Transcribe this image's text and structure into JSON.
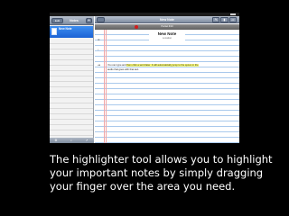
{
  "status_bar": {
    "time": ""
  },
  "left_pane": {
    "edit_label": "Edit",
    "title": "Notes",
    "add_label": "+",
    "selected_note": {
      "title": "New Note",
      "date": ""
    },
    "bottom_icons": [
      "settings-icon",
      "search-icon",
      "share-icon"
    ]
  },
  "right_pane": {
    "title": "New Note",
    "record_label": "Pocket 6/10",
    "tools": [
      "pen-icon",
      "highlighter-icon",
      "eraser-icon"
    ],
    "note": {
      "heading": "New Note",
      "location": "Location",
      "text_before": "You can type and ",
      "text_highlight": "then click a word later. It will automatically jump to the spooo in the",
      "text_line2": "audio that goes with that text."
    }
  },
  "caption": "The highlighter tool allows you to highlight your important notes by simply dragging your finger over the area you need."
}
